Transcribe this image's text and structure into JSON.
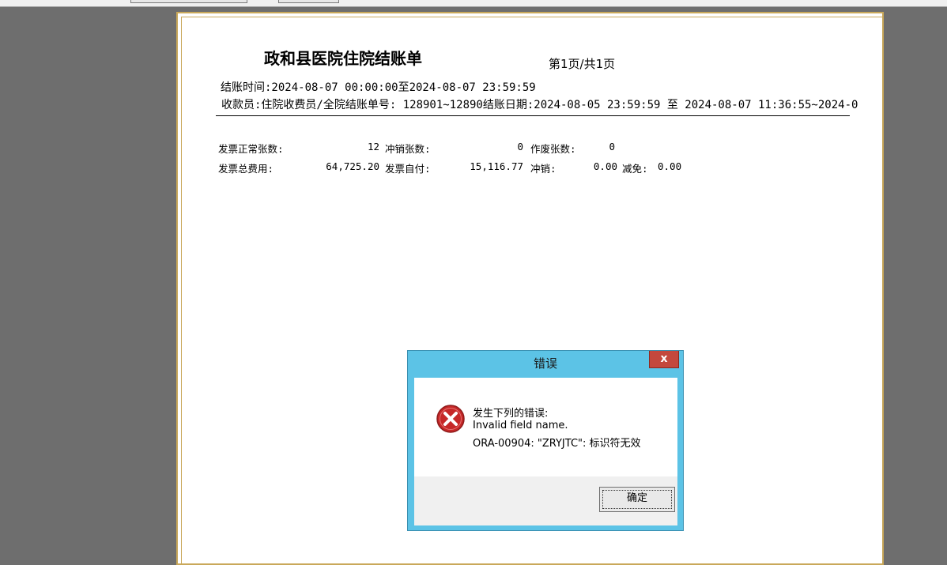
{
  "report": {
    "title": "政和县医院住院结账单",
    "page_info": "第1页/共1页",
    "settle_time": "结账时间:2024-08-07 00:00:00至2024-08-07 23:59:59",
    "cashier_line": "收款员:住院收费员/全院结账单号: 128901~12890结账日期:2024-08-05 23:59:59 至 2024-08-07 11:36:55~2024-0"
  },
  "stats": {
    "normal_count_label": "发票正常张数:",
    "normal_count_value": "12",
    "refund_count_label": "冲销张数:",
    "refund_count_value": "0",
    "void_count_label": "作废张数:",
    "void_count_value": "0",
    "total_fee_label": "发票总费用:",
    "total_fee_value": "64,725.20",
    "self_pay_label": "发票自付:",
    "self_pay_value": "15,116.77",
    "refund_amount_label": "冲销:",
    "refund_amount_value": "0.00",
    "discount_label": "减免:",
    "discount_value": "0.00"
  },
  "dialog": {
    "title": "错误",
    "close_glyph": "x",
    "message_line1": "发生下列的错误:",
    "message_line2": "Invalid field name.",
    "message_line3": "ORA-00904: \"ZRYJTC\": 标识符无效",
    "ok_label": "确定"
  },
  "icons": {
    "error": "error-icon",
    "close": "close-icon"
  },
  "colors": {
    "dialog_frame": "#5cc3e6",
    "close_button": "#c4483d",
    "error_icon": "#c62828",
    "paper_border": "#c9a85a"
  }
}
